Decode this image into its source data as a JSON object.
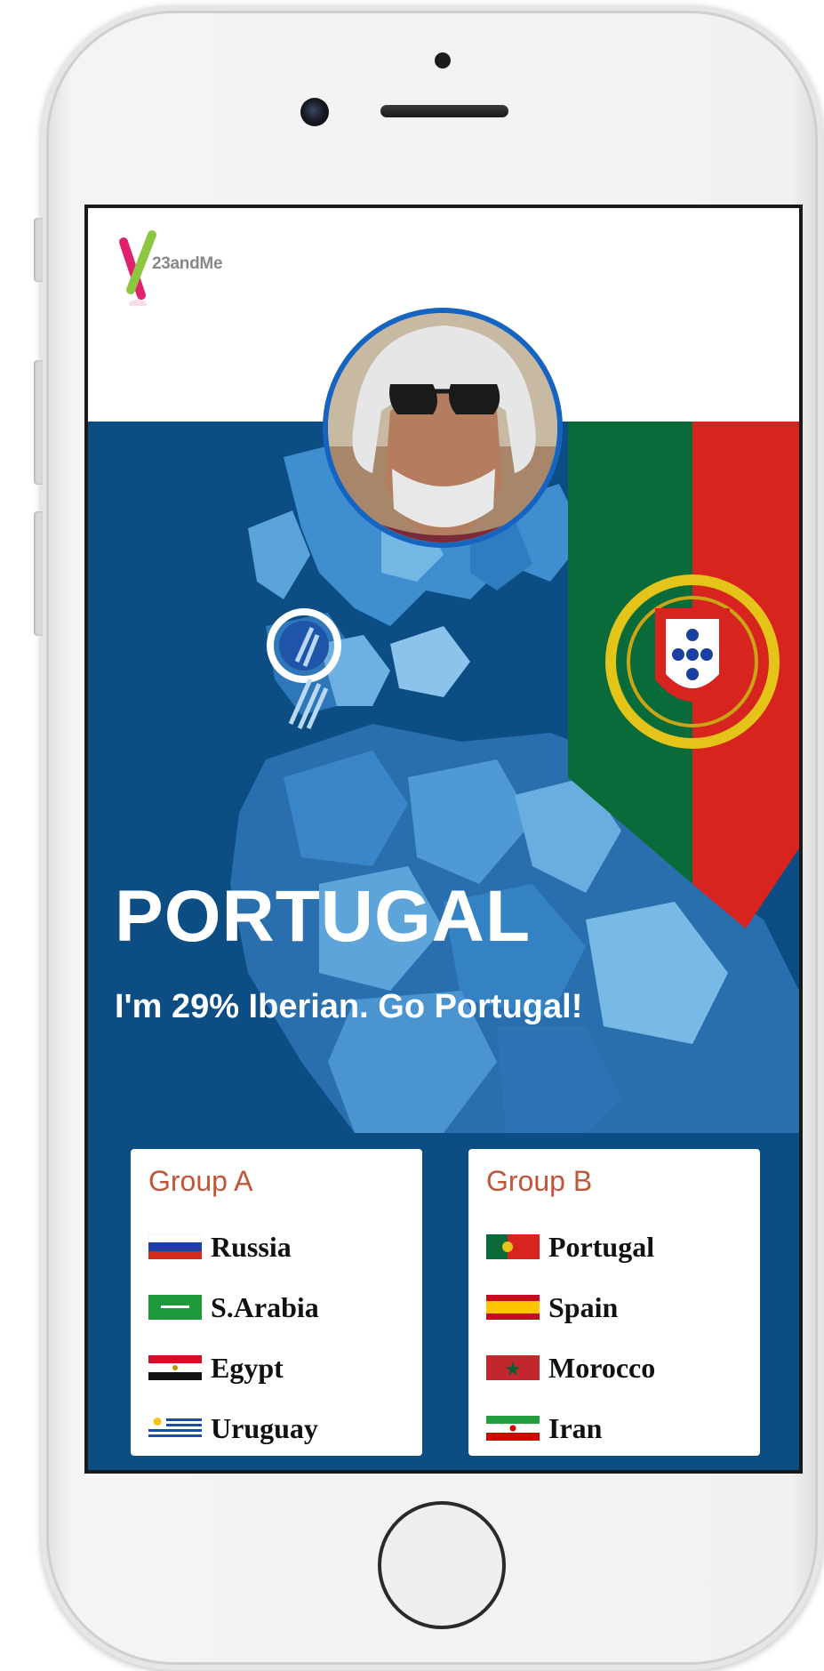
{
  "app": {
    "logo_text": "23andMe"
  },
  "hero": {
    "title": "PORTUGAL",
    "subtitle": "I'm 29% Iberian. Go Portugal!"
  },
  "groups": [
    {
      "title": "Group A",
      "teams": [
        "Russia",
        "S.Arabia",
        "Egypt",
        "Uruguay"
      ]
    },
    {
      "title": "Group B",
      "teams": [
        "Portugal",
        "Spain",
        "Morocco",
        "Iran"
      ]
    }
  ],
  "icons": [
    "23andme-logo-icon",
    "location-pin-icon",
    "portugal-flag-icon",
    "russia-flag-icon",
    "saudi-arabia-flag-icon",
    "egypt-flag-icon",
    "uruguay-flag-icon",
    "spain-flag-icon",
    "morocco-flag-icon",
    "iran-flag-icon"
  ],
  "colors": {
    "hero_bg": "#0c4d84",
    "avatar_ring": "#1565c0",
    "group_title": "#c0553a"
  }
}
